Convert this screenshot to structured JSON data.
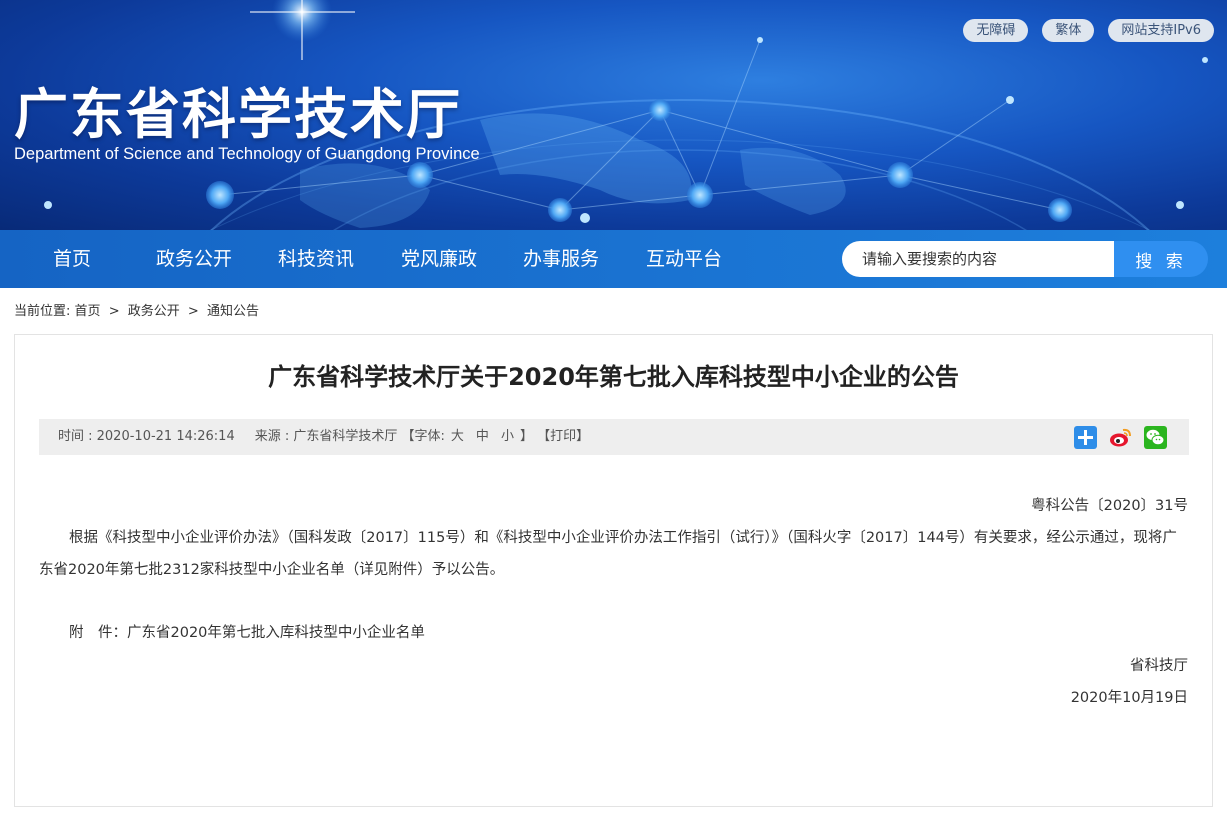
{
  "header": {
    "title": "广东省科学技术厅",
    "subtitle": "Department of Science and Technology of Guangdong Province",
    "top_links": [
      "无障碍",
      "繁体",
      "网站支持IPv6"
    ]
  },
  "nav": {
    "items": [
      "首页",
      "政务公开",
      "科技资讯",
      "党风廉政",
      "办事服务",
      "互动平台"
    ],
    "search_placeholder": "请输入要搜索的内容",
    "search_button": "搜 索"
  },
  "breadcrumb": {
    "prefix": "当前位置:",
    "items": [
      "首页",
      "政务公开",
      "通知公告"
    ],
    "separator": ">"
  },
  "article": {
    "title": "广东省科学技术厅关于2020年第七批入库科技型中小企业的公告",
    "meta": {
      "time_label": "时间 : 2020-10-21 14:26:14",
      "source_label": "来源 : 广东省科学技术厅",
      "font_label": "【字体:",
      "font_large": "大",
      "font_medium": "中",
      "font_small": "小",
      "font_close": "】",
      "print_label": "【打印】"
    },
    "share_icons": [
      "plus-share-icon",
      "weibo-icon",
      "wechat-icon"
    ],
    "doc_number": "粤科公告〔2020〕31号",
    "paragraph": "根据《科技型中小企业评价办法》（国科发政〔2017〕115号）和《科技型中小企业评价办法工作指引（试行）》（国科火字〔2017〕144号）有关要求，经公示通过，现将广东省2020年第七批2312家科技型中小企业名单（详见附件）予以公告。",
    "attachment_label": "附　件：",
    "attachment_link": "广东省2020年第七批入库科技型中小企业名单",
    "signature": "省科技厅",
    "date": "2020年10月19日"
  },
  "colors": {
    "banner_dark": "#0d3a9a",
    "nav_blue": "#1a73d2",
    "search_button": "#2f8ff0",
    "meta_bar_bg": "#eeeeee"
  }
}
